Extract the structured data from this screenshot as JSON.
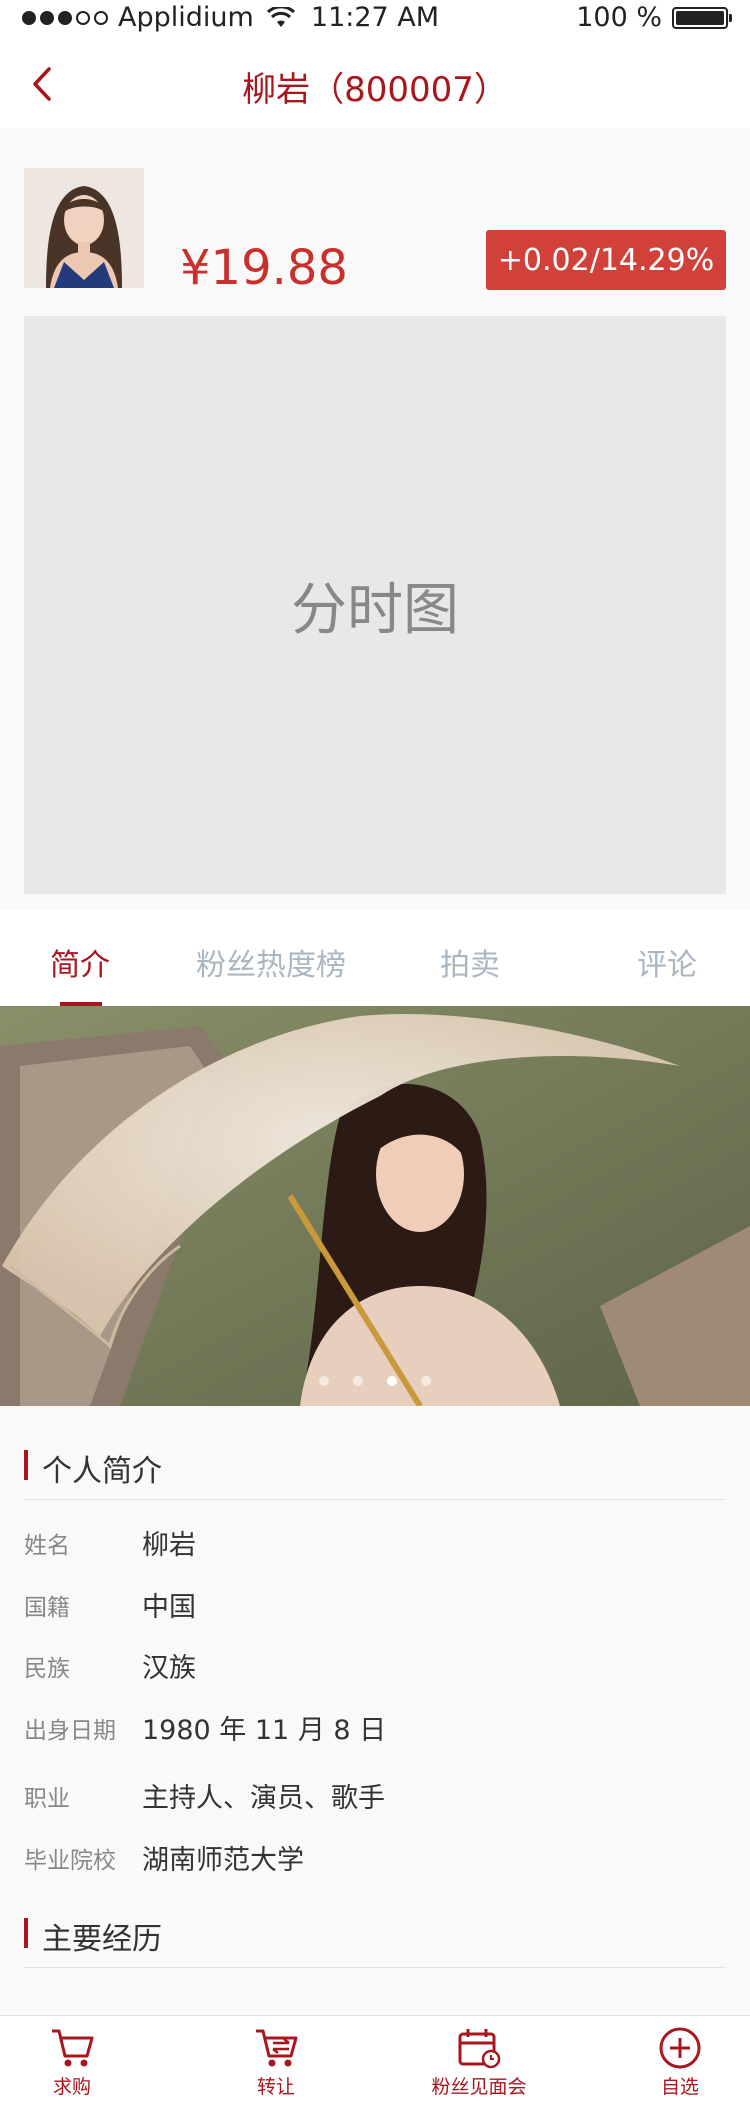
{
  "status_bar": {
    "carrier": "Applidium",
    "time": "11:27 AM",
    "battery": "100 %"
  },
  "nav": {
    "title": "柳岩（800007）"
  },
  "quote": {
    "price": "¥19.88",
    "change": "+0.02/14.29%",
    "chart_placeholder": "分时图"
  },
  "tabs": [
    {
      "label": "简介"
    },
    {
      "label": "粉丝热度榜"
    },
    {
      "label": "拍卖"
    },
    {
      "label": "评论"
    }
  ],
  "banner": {
    "total_pages": 4,
    "active_page": 3
  },
  "profile": {
    "title": "个人简介",
    "rows": [
      {
        "label": "姓名",
        "value": "柳岩"
      },
      {
        "label": "国籍",
        "value": "中国"
      },
      {
        "label": "民族",
        "value": "汉族"
      },
      {
        "label": "出身日期",
        "value": "1980 年 11 月 8 日"
      },
      {
        "label": "职业",
        "value": "主持人、演员、歌手"
      },
      {
        "label": "毕业院校",
        "value": "湖南师范大学"
      }
    ]
  },
  "experience": {
    "title": "主要经历"
  },
  "bottom_bar": [
    {
      "label": "求购",
      "icon": "cart-icon"
    },
    {
      "label": "转让",
      "icon": "cart-transfer-icon"
    },
    {
      "label": "粉丝见面会",
      "icon": "calendar-clock-icon"
    },
    {
      "label": "自选",
      "icon": "plus-circle-icon"
    }
  ],
  "colors": {
    "accent": "#a8171d",
    "price": "#c9302c",
    "badge": "#d1413a"
  }
}
